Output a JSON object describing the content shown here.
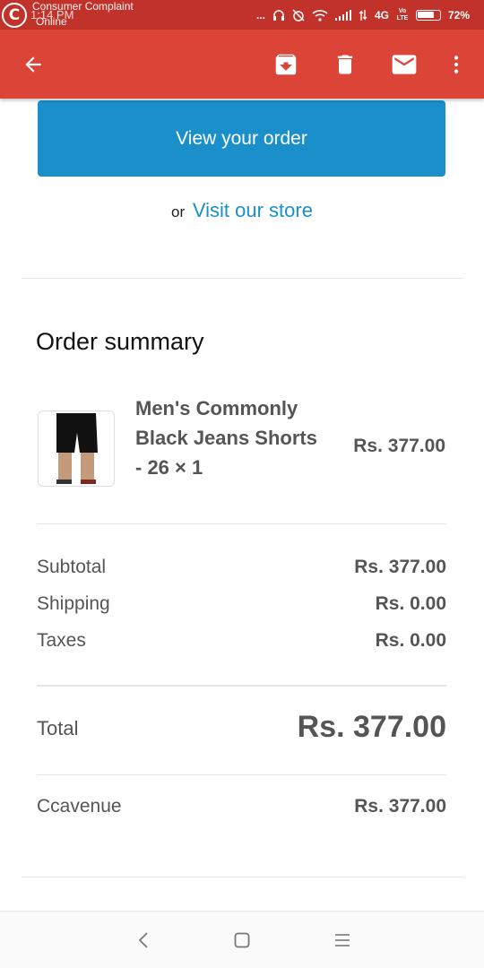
{
  "status_bar": {
    "notification_app": "Consumer Complaint",
    "notification_sub": "Online",
    "time": "1:14 PM",
    "dots": "...",
    "network": "4G",
    "volte": "Vo LTE",
    "battery": "72%"
  },
  "toolbar": {
    "back_icon": "arrow-left-icon",
    "archive_icon": "archive-icon",
    "delete_icon": "trash-icon",
    "mail_icon": "mail-icon",
    "more_icon": "more-vert-icon",
    "color": "#db4437"
  },
  "email": {
    "view_order_button": "View your order",
    "or_text": "or",
    "visit_store_link": "Visit our store",
    "accent_color": "#1a8fca"
  },
  "order_summary": {
    "title": "Order summary",
    "product": {
      "name": "Men's Commonly Black Jeans Shorts - 26 × 1",
      "price": "Rs. 377.00"
    },
    "rows": [
      {
        "label": "Subtotal",
        "value": "Rs. 377.00"
      },
      {
        "label": "Shipping",
        "value": "Rs. 0.00"
      },
      {
        "label": "Taxes",
        "value": "Rs. 0.00"
      }
    ],
    "total_label": "Total",
    "total_value": "Rs. 377.00",
    "payment_label": "Ccavenue",
    "payment_value": "Rs. 377.00"
  },
  "nav_bar": {
    "back_icon": "nav-back-icon",
    "home_icon": "nav-home-icon",
    "menu_icon": "nav-menu-icon"
  }
}
